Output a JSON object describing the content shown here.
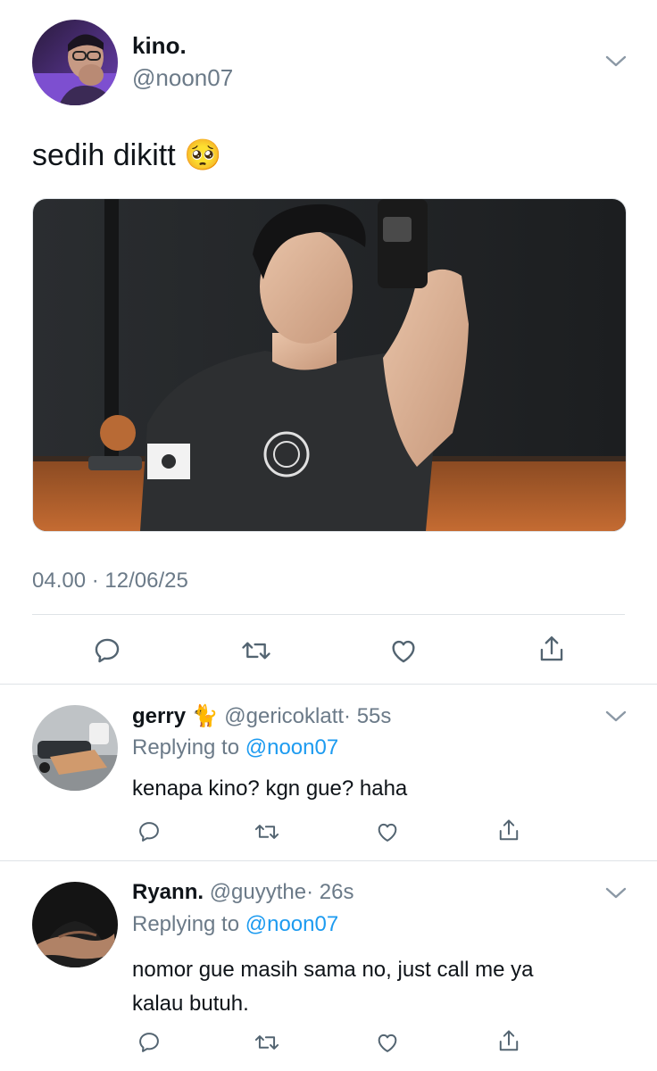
{
  "main_tweet": {
    "display_name": "kino.",
    "handle": "@noon07",
    "text": "sedih dikitt",
    "emoji": "🥺",
    "timestamp": "04.00 · 12/06/25",
    "image_alt": "Mirror selfie in a gym, man in black t-shirt"
  },
  "actions": {
    "reply_icon": "reply-icon",
    "retweet_icon": "retweet-icon",
    "like_icon": "heart-icon",
    "share_icon": "share-icon"
  },
  "replies": [
    {
      "display_name": "gerry",
      "emoji": "🐈",
      "handle": "@gericoklatt",
      "time": "· 55s",
      "replying_prefix": "Replying to",
      "replying_handle": "@noon07",
      "text": "kenapa kino? kgn gue? haha"
    },
    {
      "display_name": "Ryann.",
      "handle": "@guyythe",
      "time": "· 26s",
      "replying_prefix": "Replying to",
      "replying_handle": "@noon07",
      "text_line1": "nomor gue masih sama no, just call me ya",
      "text_line2": "kalau butuh."
    }
  ],
  "colors": {
    "text": "#0f1419",
    "muted": "#6b7a88",
    "link": "#1d9bf0",
    "divider": "#dfe3e7"
  }
}
